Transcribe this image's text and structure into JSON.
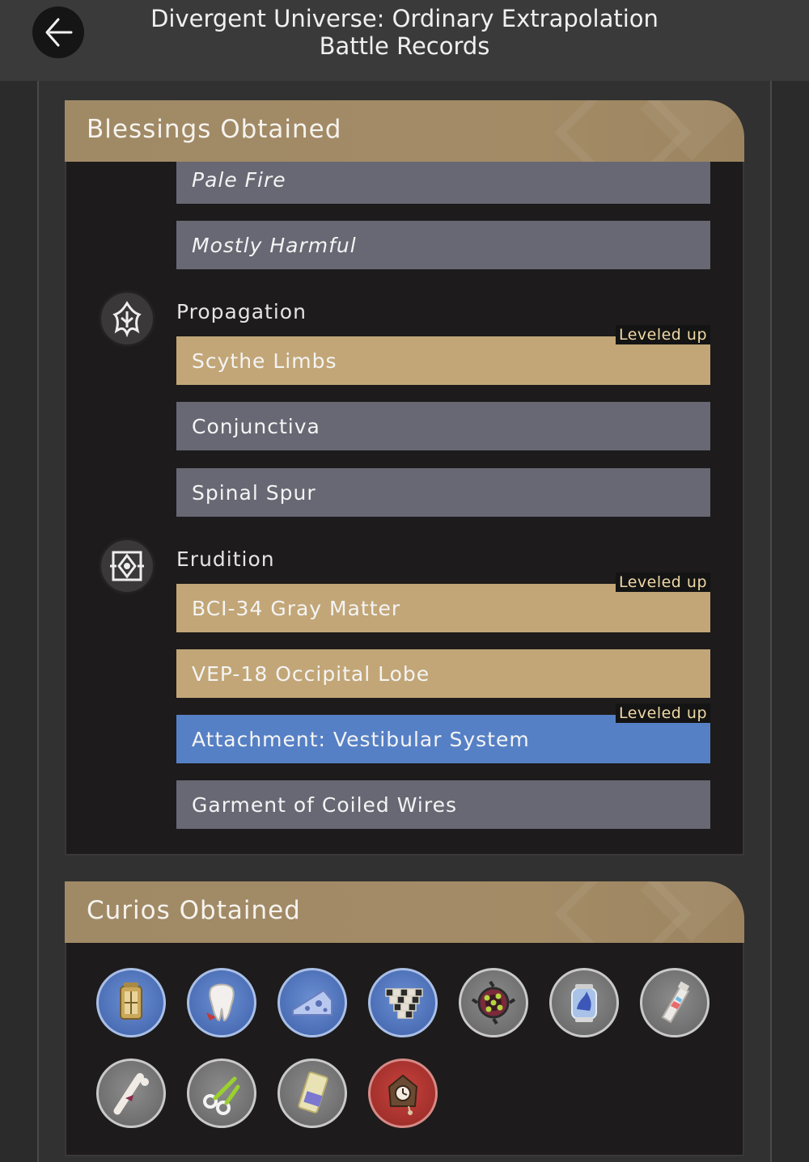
{
  "header": {
    "title_line1": "Divergent Universe: Ordinary Extrapolation",
    "title_line2": "Battle Records"
  },
  "blessings": {
    "title": "Blessings Obtained",
    "top_items": [
      {
        "label": "Pale Fire",
        "style": "gray"
      },
      {
        "label": "Mostly Harmful",
        "style": "gray"
      }
    ],
    "paths": [
      {
        "name": "Propagation",
        "icon": "propagation-icon",
        "items": [
          {
            "label": "Scythe Limbs",
            "style": "gold",
            "badge": "Leveled up"
          },
          {
            "label": "Conjunctiva",
            "style": "gray"
          },
          {
            "label": "Spinal Spur",
            "style": "gray"
          }
        ]
      },
      {
        "name": "Erudition",
        "icon": "erudition-icon",
        "items": [
          {
            "label": "BCI-34 Gray Matter",
            "style": "gold",
            "badge": "Leveled up"
          },
          {
            "label": "VEP-18 Occipital Lobe",
            "style": "gold"
          },
          {
            "label": "Attachment: Vestibular System",
            "style": "blue",
            "badge": "Leveled up"
          },
          {
            "label": "Garment of Coiled Wires",
            "style": "gray"
          }
        ]
      }
    ]
  },
  "curios": {
    "title": "Curios Obtained",
    "items": [
      {
        "icon": "lantern-icon",
        "rarity": "blue"
      },
      {
        "icon": "tooth-icon",
        "rarity": "blue"
      },
      {
        "icon": "cheese-icon",
        "rarity": "blue"
      },
      {
        "icon": "cube-stack-icon",
        "rarity": "blue"
      },
      {
        "icon": "spiked-device-icon",
        "rarity": "gray"
      },
      {
        "icon": "jar-icon",
        "rarity": "gray"
      },
      {
        "icon": "paint-tube-icon",
        "rarity": "gray"
      },
      {
        "icon": "bone-club-icon",
        "rarity": "gray"
      },
      {
        "icon": "scissors-icon",
        "rarity": "gray"
      },
      {
        "icon": "ticket-icon",
        "rarity": "gray"
      },
      {
        "icon": "cuckoo-clock-icon",
        "rarity": "red"
      }
    ]
  },
  "colors": {
    "gray_item": "#676873",
    "gold_item": "#c2a677",
    "blue_item": "#5680c5",
    "badge_text": "#f0d9a6"
  }
}
